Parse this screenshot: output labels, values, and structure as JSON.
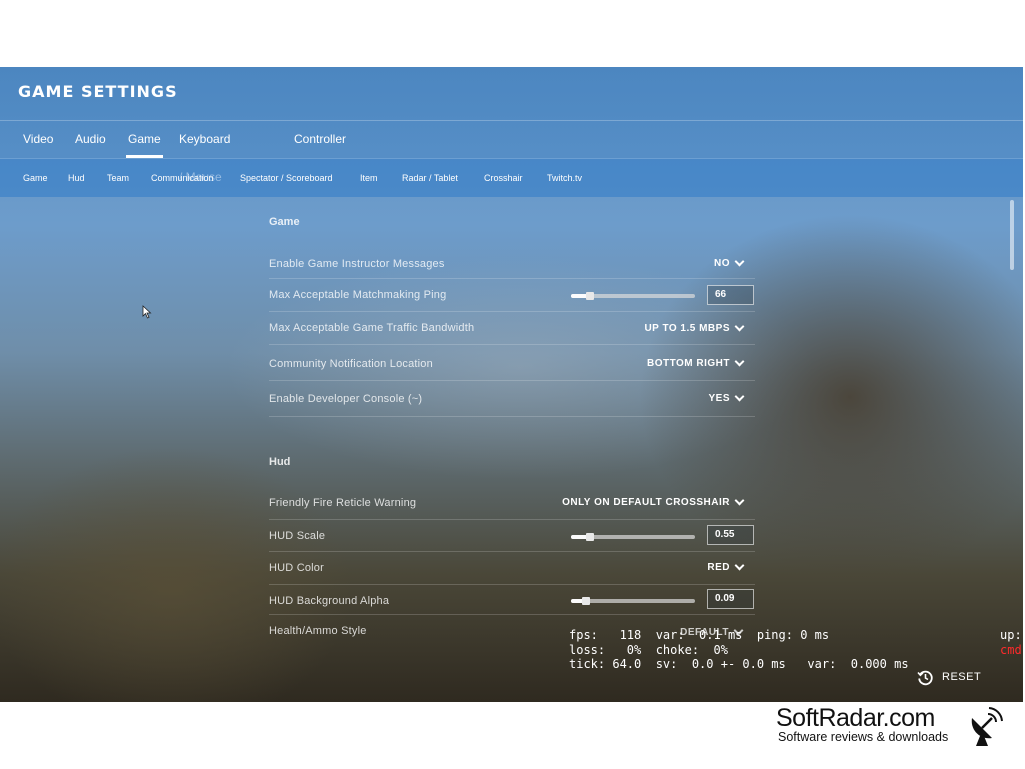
{
  "window": {
    "title": "GAME SETTINGS"
  },
  "main_tabs": [
    {
      "label": "Video"
    },
    {
      "label": "Audio"
    },
    {
      "label": "Game",
      "active": true
    },
    {
      "label": "Keyboard / Mouse"
    },
    {
      "label": "Controller"
    }
  ],
  "sub_tabs": [
    {
      "label": "Game"
    },
    {
      "label": "Hud"
    },
    {
      "label": "Team"
    },
    {
      "label": "Communication"
    },
    {
      "label": "Spectator / Scoreboard"
    },
    {
      "label": "Item"
    },
    {
      "label": "Radar / Tablet"
    },
    {
      "label": "Crosshair"
    },
    {
      "label": "Twitch.tv"
    }
  ],
  "sections": {
    "game": {
      "title": "Game",
      "rows": [
        {
          "label": "Enable Game Instructor Messages",
          "value": "NO"
        },
        {
          "label": "Max Acceptable Matchmaking Ping",
          "value": "66",
          "slider_fraction": 0.15
        },
        {
          "label": "Max Acceptable Game Traffic Bandwidth",
          "value": "UP TO 1.5 MBPS"
        },
        {
          "label": "Community Notification Location",
          "value": "BOTTOM RIGHT"
        },
        {
          "label": "Enable Developer Console (~)",
          "value": "YES"
        }
      ]
    },
    "hud": {
      "title": "Hud",
      "rows": [
        {
          "label": "Friendly Fire Reticle Warning",
          "value": "ONLY ON DEFAULT CROSSHAIR"
        },
        {
          "label": "HUD Scale",
          "value": "0.55",
          "slider_fraction": 0.15
        },
        {
          "label": "HUD Color",
          "value": "RED"
        },
        {
          "label": "HUD Background Alpha",
          "value": "0.09",
          "slider_fraction": 0.12
        },
        {
          "label": "Health/Ammo Style",
          "value": "DEFAULT"
        }
      ]
    }
  },
  "net_graph": {
    "line1": "fps:   118  var:  0.1 ms  ping: 0 ms",
    "line2": "loss:   0%  choke:  0%",
    "line3": "tick: 64.0  sv:  0.0 +- 0.0 ms   var:  0.000 ms",
    "right_up": "up:",
    "right_cmd": "cmd:"
  },
  "reset": {
    "label": "RESET"
  },
  "watermark": {
    "name": "SoftRadar.com",
    "tagline": "Software reviews & downloads"
  },
  "colors": {
    "accent": "#ffffff",
    "header_blue": "#5a93c8",
    "net_cmd_red": "#ff2a2a"
  }
}
